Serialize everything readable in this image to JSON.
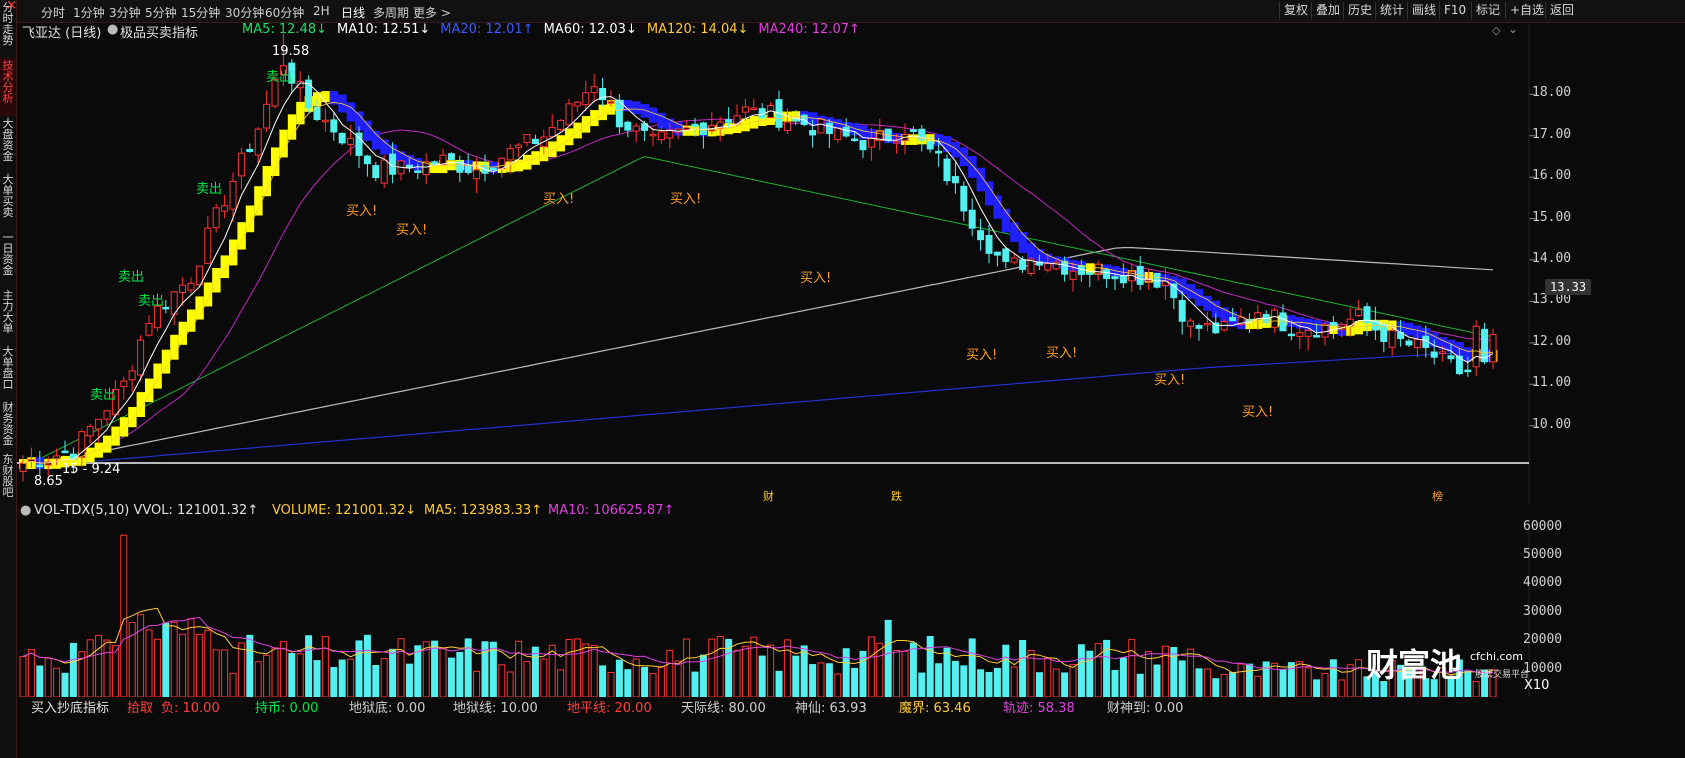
{
  "side_tabs": [
    {
      "label": "分时走势",
      "active": false
    },
    {
      "label": "技术分析",
      "active": true
    },
    {
      "label": "大盘资金",
      "active": false
    },
    {
      "label": "大单买卖",
      "active": false
    },
    {
      "label": "一日资金",
      "active": false
    },
    {
      "label": "主力大单",
      "active": false
    },
    {
      "label": "大单盘口",
      "active": false
    },
    {
      "label": "财务资金",
      "active": false
    },
    {
      "label": "东财股吧",
      "active": false
    }
  ],
  "toolbar": {
    "periods": [
      "分时",
      "1分钟",
      "3分钟",
      "5分钟",
      "15分钟",
      "30分钟",
      "60分钟",
      "2H",
      "日线",
      "多周期",
      "更多 >"
    ],
    "active_period": "日线",
    "right_buttons": [
      "复权",
      "叠加",
      "历史",
      "统计",
      "画线",
      "F10",
      "标记",
      "+自选",
      "返回"
    ]
  },
  "header": {
    "stock": "飞亚达 (日线)",
    "indicator": "极品买卖指标",
    "ma": [
      {
        "label": "MA5: 12.48↓",
        "color": "#ffffff"
      },
      {
        "label": "MA10: 12.51↓",
        "color": "#ffffff"
      },
      {
        "label": "MA20: 12.01↑",
        "color": "#3a5bff"
      },
      {
        "label": "MA60: 12.03↓",
        "color": "#ffffff"
      },
      {
        "label": "MA120: 14.04↓",
        "color": "#ffcc33"
      },
      {
        "label": "MA240: 12.07↑",
        "color": "#e040e0"
      }
    ]
  },
  "price_axis": [
    "18.00",
    "17.00",
    "16.00",
    "15.00",
    "14.00",
    "13.00",
    "12.00",
    "11.00",
    "10.00"
  ],
  "current_price": "13.33",
  "annotations": {
    "high": "19.58",
    "low": "8.65",
    "range": "15 - 9.24",
    "buy_label": "买入!",
    "sell_label": "卖出",
    "events": [
      "财",
      "跌",
      "榜"
    ]
  },
  "volume_header": {
    "title": "VOL-TDX(5,10) VVOL: 121001.32↑",
    "volume": "VOLUME: 121001.32↓",
    "ma5": "MA5: 123983.33↑",
    "ma10": "MA10: 106625.87↑"
  },
  "volume_axis": [
    "60000",
    "50000",
    "40000",
    "30000",
    "20000",
    "10000"
  ],
  "volume_unit": "X10",
  "bottom_indicator": {
    "name": "买入抄底指标",
    "items": [
      {
        "label": "拾取",
        "color": "#ff4040"
      },
      {
        "label": "负: 10.00",
        "color": "#ff4040"
      },
      {
        "label": "持币: 0.00",
        "color": "#00e84a"
      },
      {
        "label": "地狱底: 0.00",
        "color": "#cfcfcf"
      },
      {
        "label": "地狱线: 10.00",
        "color": "#cfcfcf"
      },
      {
        "label": "地平线: 20.00",
        "color": "#ff4040"
      },
      {
        "label": "天际线: 80.00",
        "color": "#cfcfcf"
      },
      {
        "label": "神仙: 63.93",
        "color": "#cfcfcf"
      },
      {
        "label": "魔界: 63.46",
        "color": "#ffcc33"
      },
      {
        "label": "轨迹: 58.38",
        "color": "#e040e0"
      },
      {
        "label": "财神到: 0.00",
        "color": "#cfcfcf"
      }
    ]
  },
  "watermark": {
    "brand": "财富池",
    "site": "cfchi.com",
    "sub": "股票交易平台"
  },
  "colors": {
    "up": "#ff3232",
    "down": "#54f0f0",
    "ma5": "#ffffff",
    "ma20": "#2230d0",
    "ma60": "#19b032",
    "ma120": "#ffcc33",
    "ma240": "#e040e0",
    "band_up": "#ffff00",
    "band_down": "#1f1fff"
  }
}
